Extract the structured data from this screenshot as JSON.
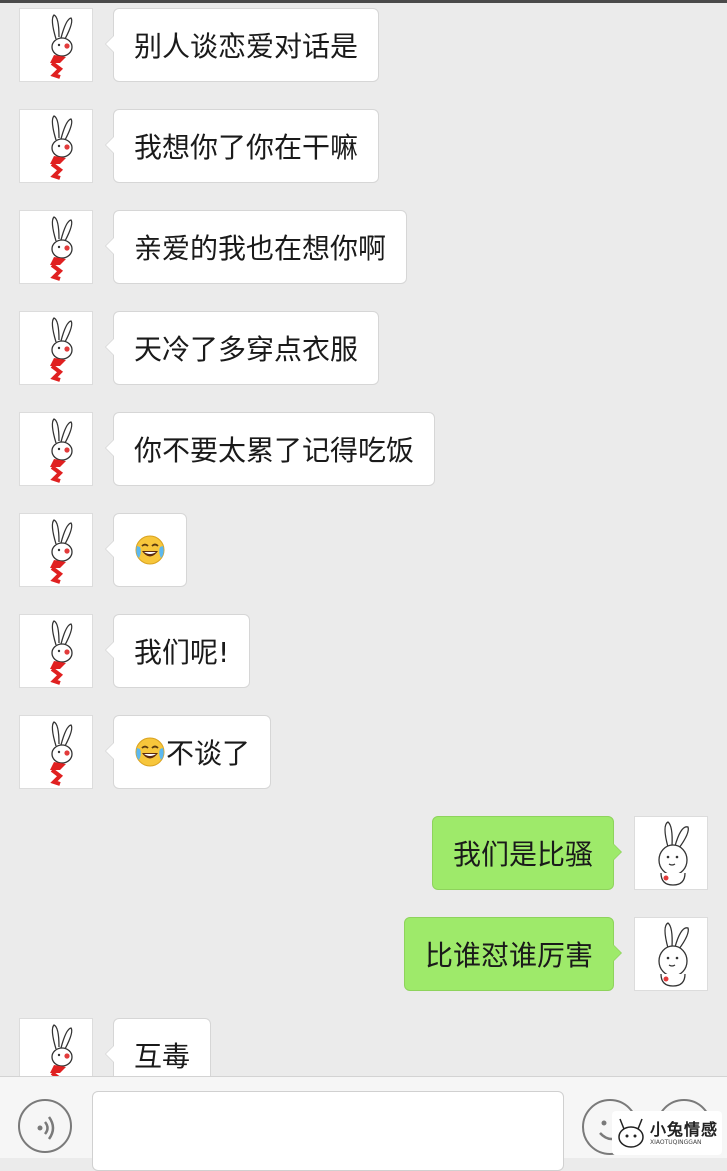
{
  "messages": [
    {
      "side": "left",
      "avatar": "rabbit-red-scarf-avatar",
      "text": "别人谈恋爱对话是"
    },
    {
      "side": "left",
      "avatar": "rabbit-red-scarf-avatar",
      "text": "我想你了你在干嘛"
    },
    {
      "side": "left",
      "avatar": "rabbit-red-scarf-avatar",
      "text": "亲爱的我也在想你啊"
    },
    {
      "side": "left",
      "avatar": "rabbit-red-scarf-avatar",
      "text": "天冷了多穿点衣服"
    },
    {
      "side": "left",
      "avatar": "rabbit-red-scarf-avatar",
      "text": "你不要太累了记得吃饭"
    },
    {
      "side": "left",
      "avatar": "rabbit-red-scarf-avatar",
      "emoji": "crying-laughing-emoji",
      "text": ""
    },
    {
      "side": "left",
      "avatar": "rabbit-red-scarf-avatar",
      "text": "我们呢!"
    },
    {
      "side": "left",
      "avatar": "rabbit-red-scarf-avatar",
      "emoji": "crying-laughing-emoji",
      "text": "不谈了"
    },
    {
      "side": "right",
      "avatar": "rabbit-white-avatar",
      "text": "我们是比骚"
    },
    {
      "side": "right",
      "avatar": "rabbit-white-avatar",
      "text": "比谁怼谁厉害"
    },
    {
      "side": "left",
      "avatar": "rabbit-red-scarf-avatar",
      "text": "互毒"
    }
  ],
  "input_bar": {
    "voice_icon": "voice-icon",
    "input_value": "",
    "emoji_icon": "emoji-icon",
    "plus_icon": "plus-icon"
  },
  "watermark": {
    "text": "小兔情感",
    "sub": "XIAOTUQINGGAN"
  },
  "colors": {
    "background": "#ebebeb",
    "received_bubble": "#ffffff",
    "sent_bubble": "#9eea6a"
  }
}
